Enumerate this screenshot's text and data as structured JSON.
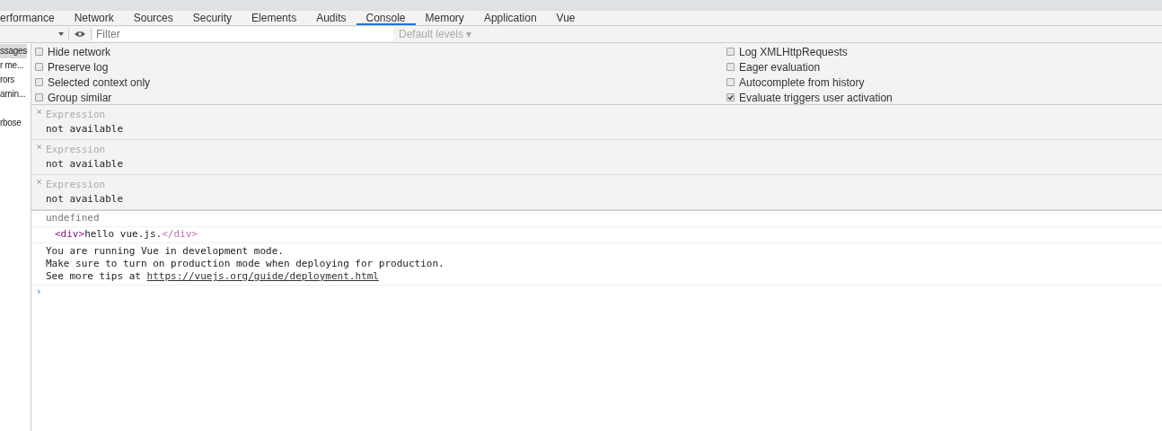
{
  "tabs": [
    {
      "label": "erformance",
      "selected": false
    },
    {
      "label": "Network",
      "selected": false
    },
    {
      "label": "Sources",
      "selected": false
    },
    {
      "label": "Security",
      "selected": false
    },
    {
      "label": "Elements",
      "selected": false
    },
    {
      "label": "Audits",
      "selected": false
    },
    {
      "label": "Console",
      "selected": true
    },
    {
      "label": "Memory",
      "selected": false
    },
    {
      "label": "Application",
      "selected": false
    },
    {
      "label": "Vue",
      "selected": false
    }
  ],
  "toolbar": {
    "filter_placeholder": "Filter",
    "levels": "Default levels ▾"
  },
  "sidebar": {
    "items": [
      {
        "label": "ssages",
        "selected": true
      },
      {
        "label": "r me...",
        "selected": false
      },
      {
        "label": "rors",
        "selected": false
      },
      {
        "label": "arnin...",
        "selected": false
      },
      {
        "label": "rbose",
        "selected": false
      }
    ]
  },
  "settings": {
    "left": [
      {
        "label": "Hide network",
        "checked": false
      },
      {
        "label": "Preserve log",
        "checked": false
      },
      {
        "label": "Selected context only",
        "checked": false
      },
      {
        "label": "Group similar",
        "checked": false
      }
    ],
    "right": [
      {
        "label": "Log XMLHttpRequests",
        "checked": false
      },
      {
        "label": "Eager evaluation",
        "checked": false
      },
      {
        "label": "Autocomplete from history",
        "checked": false
      },
      {
        "label": "Evaluate triggers user activation",
        "checked": true
      }
    ]
  },
  "watches": [
    {
      "title": "Expression",
      "value": "not available"
    },
    {
      "title": "Expression",
      "value": "not available"
    },
    {
      "title": "Expression",
      "value": "not available"
    }
  ],
  "messages": [
    {
      "kind": "result",
      "text": "undefined"
    },
    {
      "kind": "element",
      "open": "<div>",
      "body": "hello vue.js.",
      "close": "</div>"
    },
    {
      "kind": "log",
      "lines": [
        "You are running Vue in development mode.",
        "Make sure to turn on production mode when deploying for production."
      ],
      "prefix": "See more tips at ",
      "link": "https://vuejs.org/guide/deployment.html"
    }
  ],
  "prompt": "›"
}
